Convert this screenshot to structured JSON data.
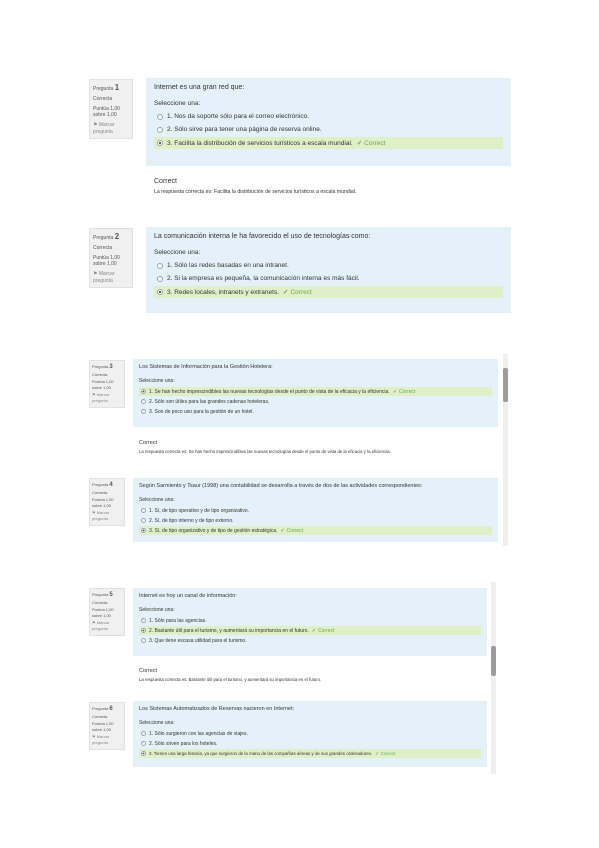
{
  "block1": {
    "questions": [
      {
        "title": "Pregunta",
        "number": "1",
        "state": "Correcta",
        "score": "Puntúa 1,00 sobre 1,00",
        "flag": "Marcar pregunta",
        "text": "Internet es una gran red que:",
        "prompt": "Seleccione una:",
        "options": [
          {
            "label": "1. Nos da soporte sólo para el correo electrónico.",
            "checked": false,
            "correct": false
          },
          {
            "label": "2. Sólo sirve para tener una página de reserva online.",
            "checked": false,
            "correct": false
          },
          {
            "label": "3. Facilita la distribución de servicios turísticos a escala mundial.",
            "checked": true,
            "correct": true
          }
        ],
        "correct_mark": "Correct",
        "feedback_title": "Correct",
        "feedback_text": "La respuesta correcta es: Facilita la distribución de servicios turísticos a escala mundial."
      },
      {
        "title": "Pregunta",
        "number": "2",
        "state": "Correcta",
        "score": "Puntúa 1,00 sobre 1,00",
        "flag": "Marcar pregunta",
        "text": "La comunicación interna le ha favorecido el uso de tecnologías como:",
        "prompt": "Seleccione una:",
        "options": [
          {
            "label": "1. Sólo las redes basadas en una intranet.",
            "checked": false,
            "correct": false
          },
          {
            "label": "2. Si la empresa es pequeña, la comunicación interna es más fácil.",
            "checked": false,
            "correct": false
          },
          {
            "label": "3. Redes locales, intranets y extranets.",
            "checked": true,
            "correct": true
          }
        ],
        "correct_mark": "Correct"
      }
    ]
  },
  "block2": {
    "questions": [
      {
        "title": "Pregunta",
        "number": "3",
        "state": "Correcta",
        "score": "Puntúa 1,00 sobre 1,00",
        "flag": "Marcar pregunta",
        "text": "Los Sistemas de Información para la Gestión Hotelera:",
        "prompt": "Seleccione una:",
        "options": [
          {
            "label": "1. Se han hecho imprescindibles las nuevas tecnologías desde el punto de vista de la eficacia y la eficiencia.",
            "checked": true,
            "correct": true
          },
          {
            "label": "2. Sólo son útiles para las grandes cadenas hoteleras.",
            "checked": false,
            "correct": false
          },
          {
            "label": "3. Son de poco uso para la gestión de un hotel.",
            "checked": false,
            "correct": false
          }
        ],
        "correct_mark": "Correct",
        "feedback_title": "Correct",
        "feedback_text": "La respuesta correcta es: Se han hecho imprescindibles las nuevas tecnologías desde el punto de vista de la eficacia y la eficiencia."
      },
      {
        "title": "Pregunta",
        "number": "4",
        "state": "Correcta",
        "score": "Puntúa 1,00 sobre 1,00",
        "flag": "Marcar pregunta",
        "text": "Según Sarmiento y Tsaur (1998) una contabilidad se desarrolla a través de dos de las actividades correspondientes:",
        "prompt": "Seleccione una:",
        "options": [
          {
            "label": "1. Sí, de tipo operativo y de tipo organizativo.",
            "checked": false,
            "correct": false
          },
          {
            "label": "2. Sí, de tipo interno y de tipo externo.",
            "checked": false,
            "correct": false
          },
          {
            "label": "3. Sí, de tipo organizativo y de tipo de gestión estratégica.",
            "checked": true,
            "correct": true
          }
        ],
        "correct_mark": "Correct"
      }
    ]
  },
  "block3": {
    "questions": [
      {
        "title": "Pregunta",
        "number": "5",
        "state": "Correcta",
        "score": "Puntúa 1,00 sobre 1,00",
        "flag": "Marcar pregunta",
        "text": "Internet es hoy un canal de información:",
        "prompt": "Seleccione una:",
        "options": [
          {
            "label": "1. Sólo para las agencias.",
            "checked": false,
            "correct": false
          },
          {
            "label": "2. Bastante útil para el turismo, y aumentará su importancia en el futuro.",
            "checked": true,
            "correct": true
          },
          {
            "label": "3. Que tiene escasa utilidad para el turismo.",
            "checked": false,
            "correct": false
          }
        ],
        "correct_mark": "Correct",
        "feedback_title": "Correct",
        "feedback_text": "La respuesta correcta es: Bastante útil para el turismo, y aumentará su importancia en el futuro."
      },
      {
        "title": "Pregunta",
        "number": "6",
        "state": "Correcta",
        "score": "Puntúa 1,00 sobre 1,00",
        "flag": "Marcar pregunta",
        "text": "Los Sistemas Automatizados de Reservas nacieron en Internet:",
        "prompt": "Seleccione una:",
        "options": [
          {
            "label": "1. Sólo surgieron con las agencias de viajes.",
            "checked": false,
            "correct": false
          },
          {
            "label": "2. Sólo sirven para los hoteles.",
            "checked": false,
            "correct": false
          },
          {
            "label": "3. Tienen una larga historia, ya que surgieron de la mano de las compañías aéreas y de sus grandes ordenadores.",
            "checked": true,
            "correct": true
          }
        ],
        "correct_mark": "Correct"
      }
    ]
  }
}
